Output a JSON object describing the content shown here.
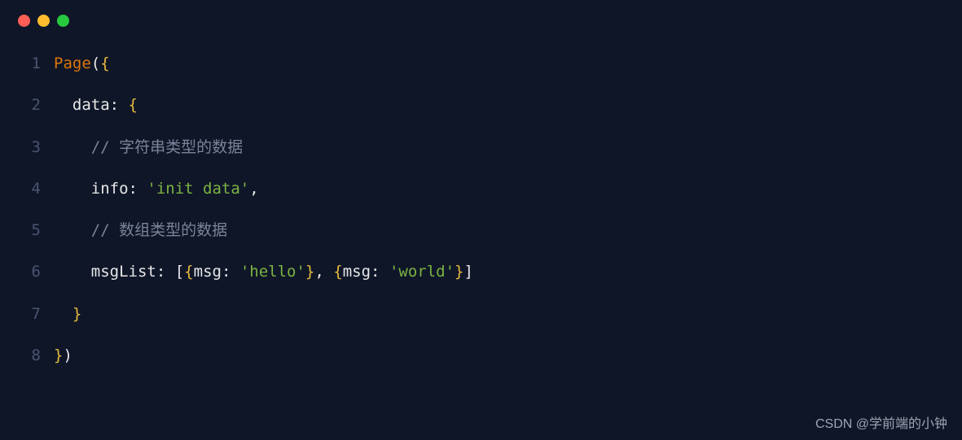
{
  "titlebar": {
    "buttons": [
      "close",
      "minimize",
      "maximize"
    ]
  },
  "code": {
    "lines": [
      {
        "num": "1",
        "tokens": [
          {
            "cls": "tok-func",
            "text": "Page"
          },
          {
            "cls": "tok-punc",
            "text": "("
          },
          {
            "cls": "tok-brace",
            "text": "{"
          }
        ]
      },
      {
        "num": "2",
        "tokens": [
          {
            "cls": "tok-default",
            "text": "  "
          },
          {
            "cls": "tok-key",
            "text": "data"
          },
          {
            "cls": "tok-punc",
            "text": ": "
          },
          {
            "cls": "tok-brace",
            "text": "{"
          }
        ]
      },
      {
        "num": "3",
        "tokens": [
          {
            "cls": "tok-default",
            "text": "    "
          },
          {
            "cls": "tok-comment",
            "text": "// 字符串类型的数据"
          }
        ]
      },
      {
        "num": "4",
        "tokens": [
          {
            "cls": "tok-default",
            "text": "    "
          },
          {
            "cls": "tok-key",
            "text": "info"
          },
          {
            "cls": "tok-punc",
            "text": ": "
          },
          {
            "cls": "tok-string",
            "text": "'init data'"
          },
          {
            "cls": "tok-punc",
            "text": ","
          }
        ]
      },
      {
        "num": "5",
        "tokens": [
          {
            "cls": "tok-default",
            "text": "    "
          },
          {
            "cls": "tok-comment",
            "text": "// 数组类型的数据"
          }
        ]
      },
      {
        "num": "6",
        "tokens": [
          {
            "cls": "tok-default",
            "text": "    "
          },
          {
            "cls": "tok-key",
            "text": "msgList"
          },
          {
            "cls": "tok-punc",
            "text": ": ["
          },
          {
            "cls": "tok-brace",
            "text": "{"
          },
          {
            "cls": "tok-key",
            "text": "msg"
          },
          {
            "cls": "tok-punc",
            "text": ": "
          },
          {
            "cls": "tok-string",
            "text": "'hello'"
          },
          {
            "cls": "tok-brace",
            "text": "}"
          },
          {
            "cls": "tok-punc",
            "text": ", "
          },
          {
            "cls": "tok-brace",
            "text": "{"
          },
          {
            "cls": "tok-key",
            "text": "msg"
          },
          {
            "cls": "tok-punc",
            "text": ": "
          },
          {
            "cls": "tok-string",
            "text": "'world'"
          },
          {
            "cls": "tok-brace",
            "text": "}"
          },
          {
            "cls": "tok-punc",
            "text": "]"
          }
        ]
      },
      {
        "num": "7",
        "tokens": [
          {
            "cls": "tok-default",
            "text": "  "
          },
          {
            "cls": "tok-brace",
            "text": "}"
          }
        ]
      },
      {
        "num": "8",
        "tokens": [
          {
            "cls": "tok-brace",
            "text": "}"
          },
          {
            "cls": "tok-punc",
            "text": ")"
          }
        ]
      }
    ]
  },
  "watermark": "CSDN @学前端的小钟"
}
